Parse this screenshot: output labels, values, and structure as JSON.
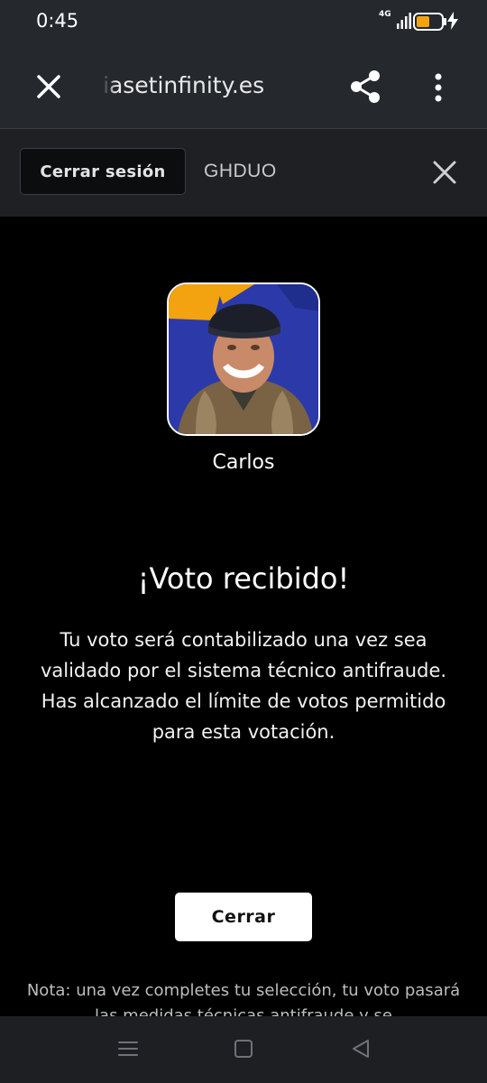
{
  "status_bar": {
    "time": "0:45",
    "network": "4G",
    "battery_level": 0.55,
    "charging": true,
    "icons": [
      "signal-icon",
      "battery-icon",
      "charging-bolt-icon"
    ]
  },
  "browser": {
    "url": "iasetinfinity.es",
    "icons": [
      "close-icon",
      "share-icon",
      "more-vert-icon"
    ]
  },
  "session": {
    "logout_label": "Cerrar sesión",
    "user_code": "GHDUO"
  },
  "candidate": {
    "name": "Carlos"
  },
  "confirmation": {
    "title": "¡Voto recibido!",
    "message": "Tu voto será contabilizado una vez sea validado por el sistema técnico antifraude. Has alcanzado el límite de votos permitido para esta votación.",
    "close_label": "Cerrar",
    "note": "Nota: una vez completes tu selección, tu voto pasará las medidas técnicas antifraude y se"
  },
  "navigation": {
    "icons": [
      "menu-icon",
      "home-icon",
      "back-icon"
    ]
  },
  "colors": {
    "accent_yellow": "#f3a30f",
    "bar_bg": "#25282d",
    "button_white": "#ffffff"
  }
}
